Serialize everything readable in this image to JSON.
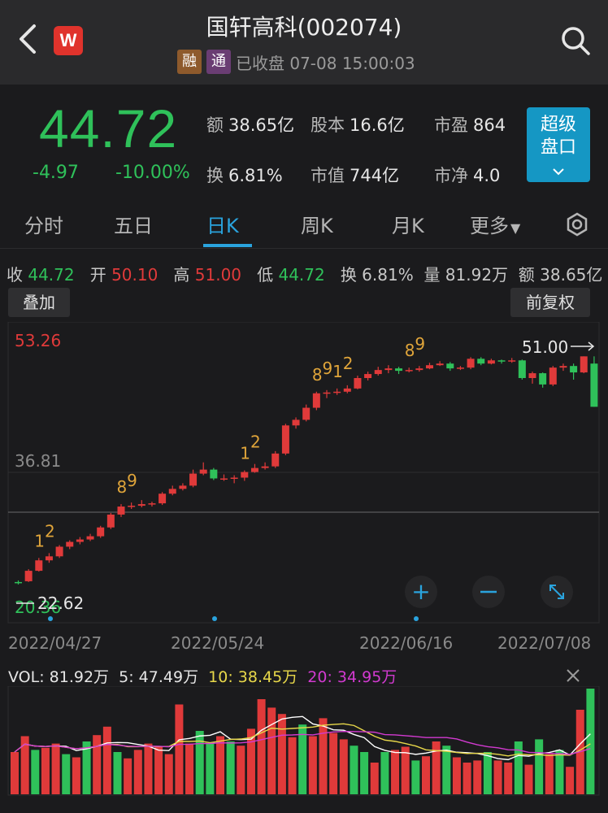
{
  "header": {
    "title": "国轩高科(002074)",
    "logo": "W",
    "tag_rong": "融",
    "tag_tong": "通",
    "status": "已收盘 07-08 15:00:03"
  },
  "quote": {
    "price": "44.72",
    "change": "-4.97",
    "change_pct": "-10.00%",
    "amount_label": "额",
    "amount": "38.65亿",
    "shares_label": "股本",
    "shares": "16.6亿",
    "pe_label": "市盈",
    "pe": "864",
    "turnover_label": "换",
    "turnover": "6.81%",
    "mktcap_label": "市值",
    "mktcap": "744亿",
    "pb_label": "市净",
    "pb": "4.0",
    "super_btn_line1": "超级",
    "super_btn_line2": "盘口",
    "colors": {
      "up": "#e03a3a",
      "down": "#2fc15a",
      "accent": "#2aa3dd"
    }
  },
  "tabs": [
    "分时",
    "五日",
    "日K",
    "周K",
    "月K",
    "更多"
  ],
  "active_tab": "日K",
  "day_info": {
    "close_label": "收",
    "close": "44.72",
    "open_label": "开",
    "open": "50.10",
    "high_label": "高",
    "high": "51.00",
    "low_label": "低",
    "low": "44.72",
    "turn_label": "换",
    "turn": "6.81%",
    "vol_label": "量",
    "vol": "81.92万",
    "amt_label": "额",
    "amt": "38.65亿"
  },
  "buttons": {
    "overlay": "叠加",
    "adjust": "前复权"
  },
  "chart_data": {
    "type": "candlestick",
    "y_labels": {
      "top": "53.26",
      "mid": "36.81",
      "bottom": "20.36"
    },
    "annotations": {
      "max": "51.00",
      "min": "22.62"
    },
    "x_labels": [
      "2022/04/27",
      "2022/05/24",
      "2022/06/16",
      "2022/07/08"
    ],
    "ylim": [
      20.36,
      53.26
    ],
    "candles": [
      [
        22.9,
        22.8,
        23.1,
        22.6
      ],
      [
        23.0,
        24.3,
        24.5,
        22.9
      ],
      [
        24.3,
        25.6,
        25.9,
        24.2
      ],
      [
        25.6,
        26.1,
        26.5,
        25.3
      ],
      [
        26.1,
        27.3,
        27.5,
        25.9
      ],
      [
        27.3,
        27.9,
        28.1,
        27.0
      ],
      [
        27.9,
        28.2,
        28.5,
        27.6
      ],
      [
        28.2,
        28.6,
        28.9,
        28.0
      ],
      [
        28.6,
        29.7,
        29.9,
        28.4
      ],
      [
        29.7,
        31.3,
        31.5,
        29.5
      ],
      [
        31.3,
        32.3,
        32.6,
        31.0
      ],
      [
        32.3,
        32.4,
        32.8,
        32.0
      ],
      [
        32.4,
        32.6,
        33.1,
        32.2
      ],
      [
        32.6,
        32.7,
        32.9,
        32.3
      ],
      [
        32.7,
        33.9,
        34.1,
        32.5
      ],
      [
        33.9,
        34.5,
        34.9,
        33.7
      ],
      [
        34.5,
        34.9,
        35.2,
        34.3
      ],
      [
        34.9,
        36.4,
        36.9,
        34.7
      ],
      [
        36.4,
        36.9,
        37.8,
        36.2
      ],
      [
        36.9,
        35.8,
        37.1,
        35.6
      ],
      [
        35.8,
        35.8,
        36.3,
        35.5
      ],
      [
        35.8,
        35.9,
        36.2,
        35.2
      ],
      [
        35.9,
        36.6,
        36.8,
        35.5
      ],
      [
        36.6,
        37.1,
        37.6,
        36.5
      ],
      [
        37.1,
        37.3,
        37.8,
        36.9
      ],
      [
        37.3,
        38.9,
        39.2,
        37.1
      ],
      [
        38.9,
        42.4,
        42.6,
        38.7
      ],
      [
        42.4,
        43.1,
        43.4,
        42.0
      ],
      [
        43.1,
        44.6,
        45.0,
        42.9
      ],
      [
        44.6,
        46.4,
        46.6,
        44.3
      ],
      [
        46.4,
        46.5,
        46.8,
        45.8
      ],
      [
        46.5,
        46.6,
        47.0,
        46.2
      ],
      [
        46.6,
        47.0,
        47.4,
        46.4
      ],
      [
        47.0,
        48.3,
        48.6,
        46.9
      ],
      [
        48.3,
        48.8,
        49.1,
        48.0
      ],
      [
        48.8,
        49.3,
        49.7,
        48.6
      ],
      [
        49.3,
        49.5,
        49.9,
        48.9
      ],
      [
        49.5,
        49.2,
        49.7,
        48.8
      ],
      [
        49.2,
        49.3,
        49.6,
        49.0
      ],
      [
        49.3,
        49.5,
        49.8,
        49.1
      ],
      [
        49.5,
        49.9,
        50.2,
        49.4
      ],
      [
        49.9,
        50.1,
        50.4,
        49.8
      ],
      [
        50.1,
        49.5,
        50.3,
        49.2
      ],
      [
        49.5,
        49.6,
        49.8,
        49.3
      ],
      [
        49.6,
        50.7,
        50.9,
        49.4
      ],
      [
        50.7,
        50.1,
        50.9,
        49.9
      ],
      [
        50.1,
        50.5,
        50.7,
        50.0
      ],
      [
        50.5,
        50.4,
        50.6,
        50.1
      ],
      [
        50.4,
        50.5,
        50.8,
        50.2
      ],
      [
        50.5,
        48.3,
        50.6,
        48.1
      ],
      [
        48.3,
        48.9,
        49.1,
        47.6
      ],
      [
        48.9,
        47.5,
        49.0,
        47.1
      ],
      [
        47.5,
        49.6,
        49.8,
        47.3
      ],
      [
        49.6,
        49.8,
        50.1,
        49.2
      ],
      [
        49.8,
        49.0,
        50.1,
        48.1
      ],
      [
        49.0,
        51.0,
        51.0,
        48.9
      ],
      [
        50.1,
        44.72,
        51.0,
        44.72
      ]
    ],
    "markers": [
      {
        "i": 2,
        "t": "1"
      },
      {
        "i": 3,
        "t": "2"
      },
      {
        "i": 10,
        "t": "8"
      },
      {
        "i": 11,
        "t": "9"
      },
      {
        "i": 22,
        "t": "1"
      },
      {
        "i": 23,
        "t": "2"
      },
      {
        "i": 29,
        "t": "8"
      },
      {
        "i": 30,
        "t": "9"
      },
      {
        "i": 31,
        "t": "1"
      },
      {
        "i": 32,
        "t": "2"
      },
      {
        "i": 38,
        "t": "8"
      },
      {
        "i": 39,
        "t": "9"
      }
    ],
    "volumes": [
      {
        "v": 40,
        "up": true
      },
      {
        "v": 55,
        "up": true
      },
      {
        "v": 42,
        "up": false
      },
      {
        "v": 44,
        "up": true
      },
      {
        "v": 48,
        "up": true
      },
      {
        "v": 38,
        "up": false
      },
      {
        "v": 35,
        "up": true
      },
      {
        "v": 50,
        "up": false
      },
      {
        "v": 56,
        "up": true
      },
      {
        "v": 64,
        "up": true
      },
      {
        "v": 40,
        "up": false
      },
      {
        "v": 34,
        "up": true
      },
      {
        "v": 42,
        "up": true
      },
      {
        "v": 48,
        "up": true
      },
      {
        "v": 45,
        "up": true
      },
      {
        "v": 38,
        "up": true
      },
      {
        "v": 85,
        "up": true
      },
      {
        "v": 48,
        "up": true
      },
      {
        "v": 60,
        "up": false
      },
      {
        "v": 48,
        "up": false
      },
      {
        "v": 55,
        "up": true
      },
      {
        "v": 50,
        "up": false
      },
      {
        "v": 46,
        "up": true
      },
      {
        "v": 62,
        "up": true
      },
      {
        "v": 90,
        "up": true
      },
      {
        "v": 82,
        "up": true
      },
      {
        "v": 76,
        "up": true
      },
      {
        "v": 54,
        "up": true
      },
      {
        "v": 66,
        "up": false
      },
      {
        "v": 55,
        "up": true
      },
      {
        "v": 72,
        "up": true
      },
      {
        "v": 58,
        "up": true
      },
      {
        "v": 52,
        "up": true
      },
      {
        "v": 46,
        "up": false
      },
      {
        "v": 40,
        "up": false
      },
      {
        "v": 30,
        "up": true
      },
      {
        "v": 40,
        "up": false
      },
      {
        "v": 42,
        "up": true
      },
      {
        "v": 45,
        "up": true
      },
      {
        "v": 32,
        "up": false
      },
      {
        "v": 36,
        "up": true
      },
      {
        "v": 50,
        "up": true
      },
      {
        "v": 46,
        "up": false
      },
      {
        "v": 35,
        "up": true
      },
      {
        "v": 30,
        "up": true
      },
      {
        "v": 32,
        "up": true
      },
      {
        "v": 40,
        "up": false
      },
      {
        "v": 32,
        "up": true
      },
      {
        "v": 30,
        "up": true
      },
      {
        "v": 50,
        "up": false
      },
      {
        "v": 28,
        "up": true
      },
      {
        "v": 52,
        "up": false
      },
      {
        "v": 38,
        "up": true
      },
      {
        "v": 42,
        "up": false
      },
      {
        "v": 26,
        "up": true
      },
      {
        "v": 80,
        "up": true
      },
      {
        "v": 100,
        "up": false
      }
    ],
    "volume_legend": {
      "vol_label": "VOL: 81.92万",
      "ma5": "5: 47.49万",
      "ma10": "10: 38.45万",
      "ma20": "20: 34.95万",
      "ma5_color": "#ffffff",
      "ma10_color": "#e8d84a",
      "ma20_color": "#d23ad0"
    }
  }
}
